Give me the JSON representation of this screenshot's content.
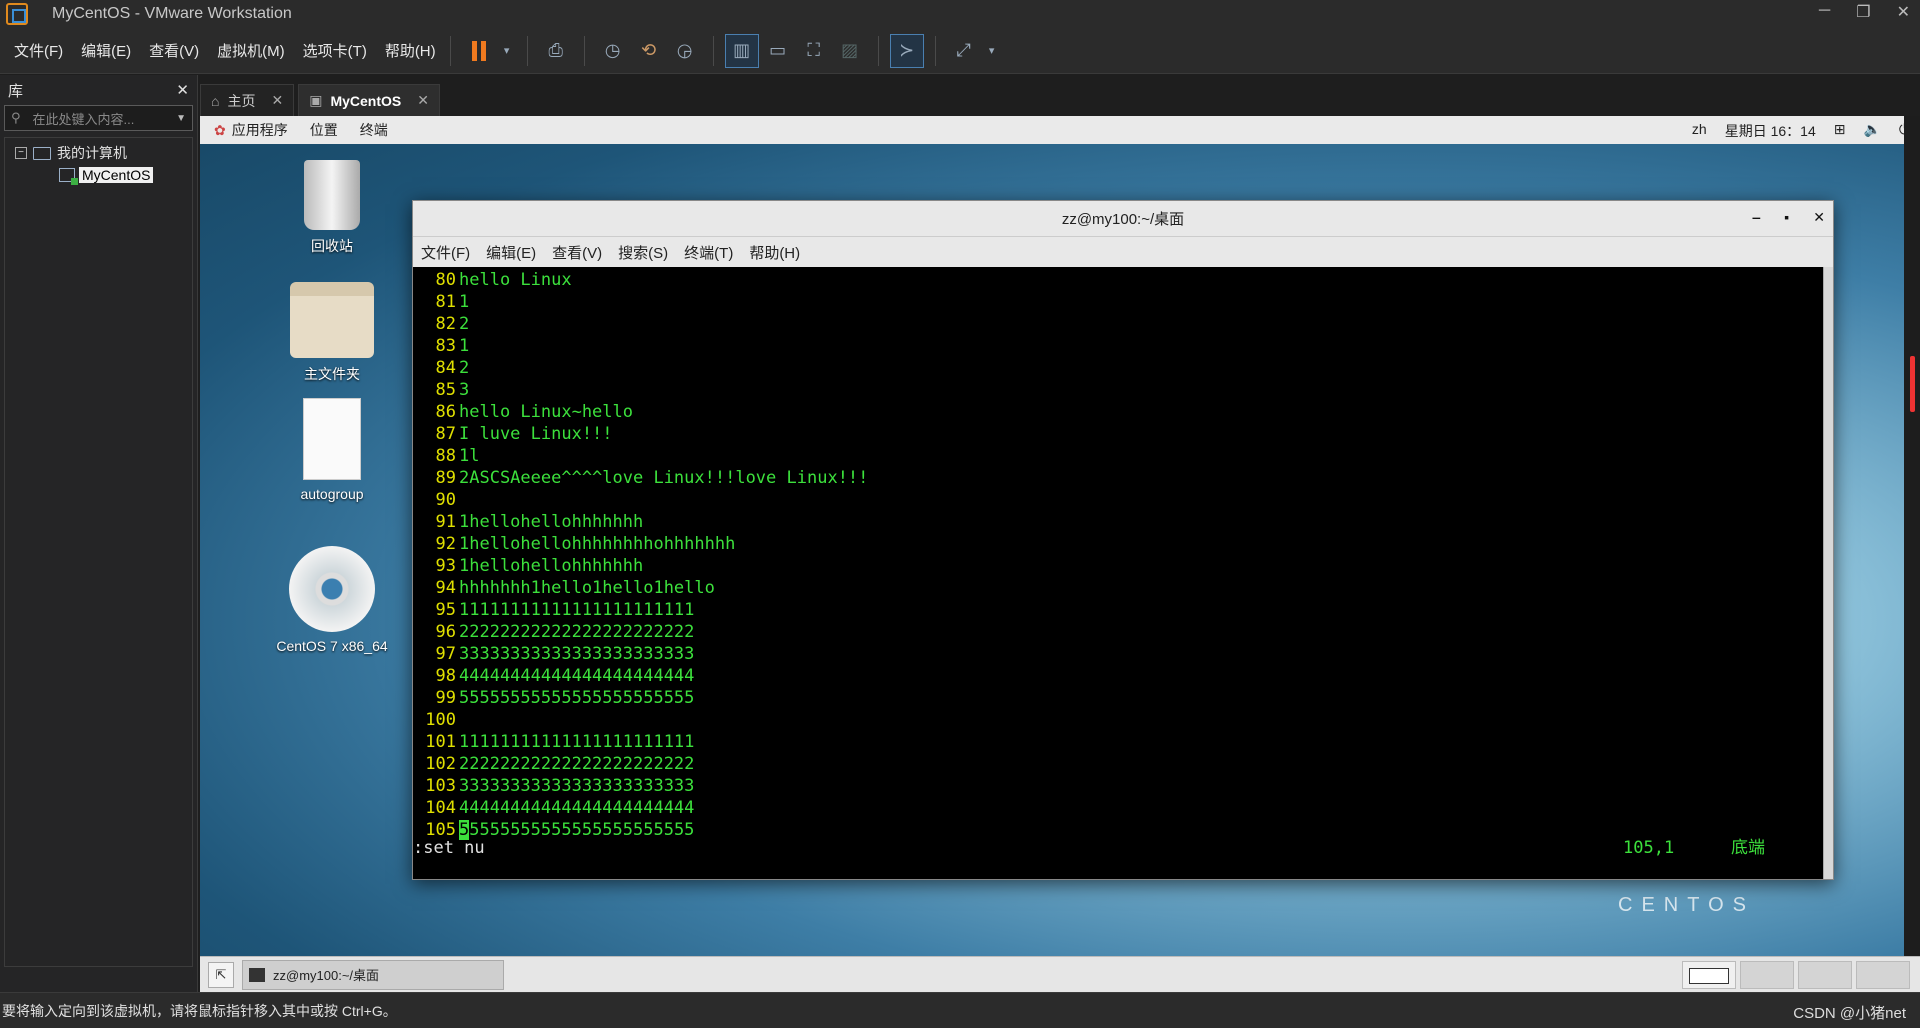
{
  "window": {
    "title": "MyCentOS - VMware Workstation",
    "minimize": "─",
    "restore": "❐",
    "close": "✕"
  },
  "menu": [
    "文件(F)",
    "编辑(E)",
    "查看(V)",
    "虚拟机(M)",
    "选项卡(T)",
    "帮助(H)"
  ],
  "library": {
    "title": "库",
    "close": "✕",
    "search_placeholder": "在此处键入内容...",
    "tree": {
      "root": "我的计算机",
      "toggle": "−",
      "child": "MyCentOS"
    }
  },
  "tabs": [
    {
      "label": "主页",
      "close": "✕"
    },
    {
      "label": "MyCentOS",
      "close": "✕"
    }
  ],
  "gnome": {
    "apps": "应用程序",
    "places": "位置",
    "terminal": "终端",
    "lang": "zh",
    "clock": "星期日 16：14"
  },
  "desktop_icons": [
    "回收站",
    "主文件夹",
    "autogroup",
    "CentOS 7 x86_64"
  ],
  "terminal": {
    "title": "zz@my100:~/桌面",
    "min": "‒",
    "max": "▪",
    "close": "✕",
    "menu": [
      "文件(F)",
      "编辑(E)",
      "查看(V)",
      "搜索(S)",
      "终端(T)",
      "帮助(H)"
    ],
    "lines": [
      {
        "n": "80",
        "t": "hello Linux"
      },
      {
        "n": "81",
        "t": "1"
      },
      {
        "n": "82",
        "t": "2"
      },
      {
        "n": "83",
        "t": "1"
      },
      {
        "n": "84",
        "t": "2"
      },
      {
        "n": "85",
        "t": "3"
      },
      {
        "n": "86",
        "t": "hello Linux~hello"
      },
      {
        "n": "87",
        "t": "I luve Linux!!!"
      },
      {
        "n": "88",
        "t": "1l"
      },
      {
        "n": "89",
        "t": "2ASCSAeeee^^^^love Linux!!!love Linux!!!"
      },
      {
        "n": "90",
        "t": ""
      },
      {
        "n": "91",
        "t": "1hellohellohhhhhhh"
      },
      {
        "n": "92",
        "t": "1hellohellohhhhhhhhohhhhhhh"
      },
      {
        "n": "93",
        "t": "1hellohellohhhhhhh"
      },
      {
        "n": "94",
        "t": "hhhhhhh1hello1hello1hello"
      },
      {
        "n": "95",
        "t": "11111111111111111111111"
      },
      {
        "n": "96",
        "t": "22222222222222222222222"
      },
      {
        "n": "97",
        "t": "33333333333333333333333"
      },
      {
        "n": "98",
        "t": "44444444444444444444444"
      },
      {
        "n": "99",
        "t": "55555555555555555555555"
      },
      {
        "n": "100",
        "t": ""
      },
      {
        "n": "101",
        "t": "11111111111111111111111"
      },
      {
        "n": "102",
        "t": "22222222222222222222222"
      },
      {
        "n": "103",
        "t": "33333333333333333333333"
      },
      {
        "n": "104",
        "t": "44444444444444444444444"
      }
    ],
    "last_line": {
      "n": "105",
      "cursor_char": "5",
      "rest": "5555555555555555555555"
    },
    "cmd": ":set nu",
    "position": "105,1",
    "scroll_pos": "底端"
  },
  "centos_logo": "CENTOS",
  "taskbar": {
    "task": "zz@my100:~/桌面"
  },
  "statusbar": {
    "message": "要将输入定向到该虚拟机，请将鼠标指针移入其中或按 Ctrl+G。",
    "watermark": "CSDN @小猪net"
  },
  "colors": {
    "accent": "#f07a1f",
    "terminal_text": "#3ce03c",
    "line_numbers": "#e0e000"
  }
}
